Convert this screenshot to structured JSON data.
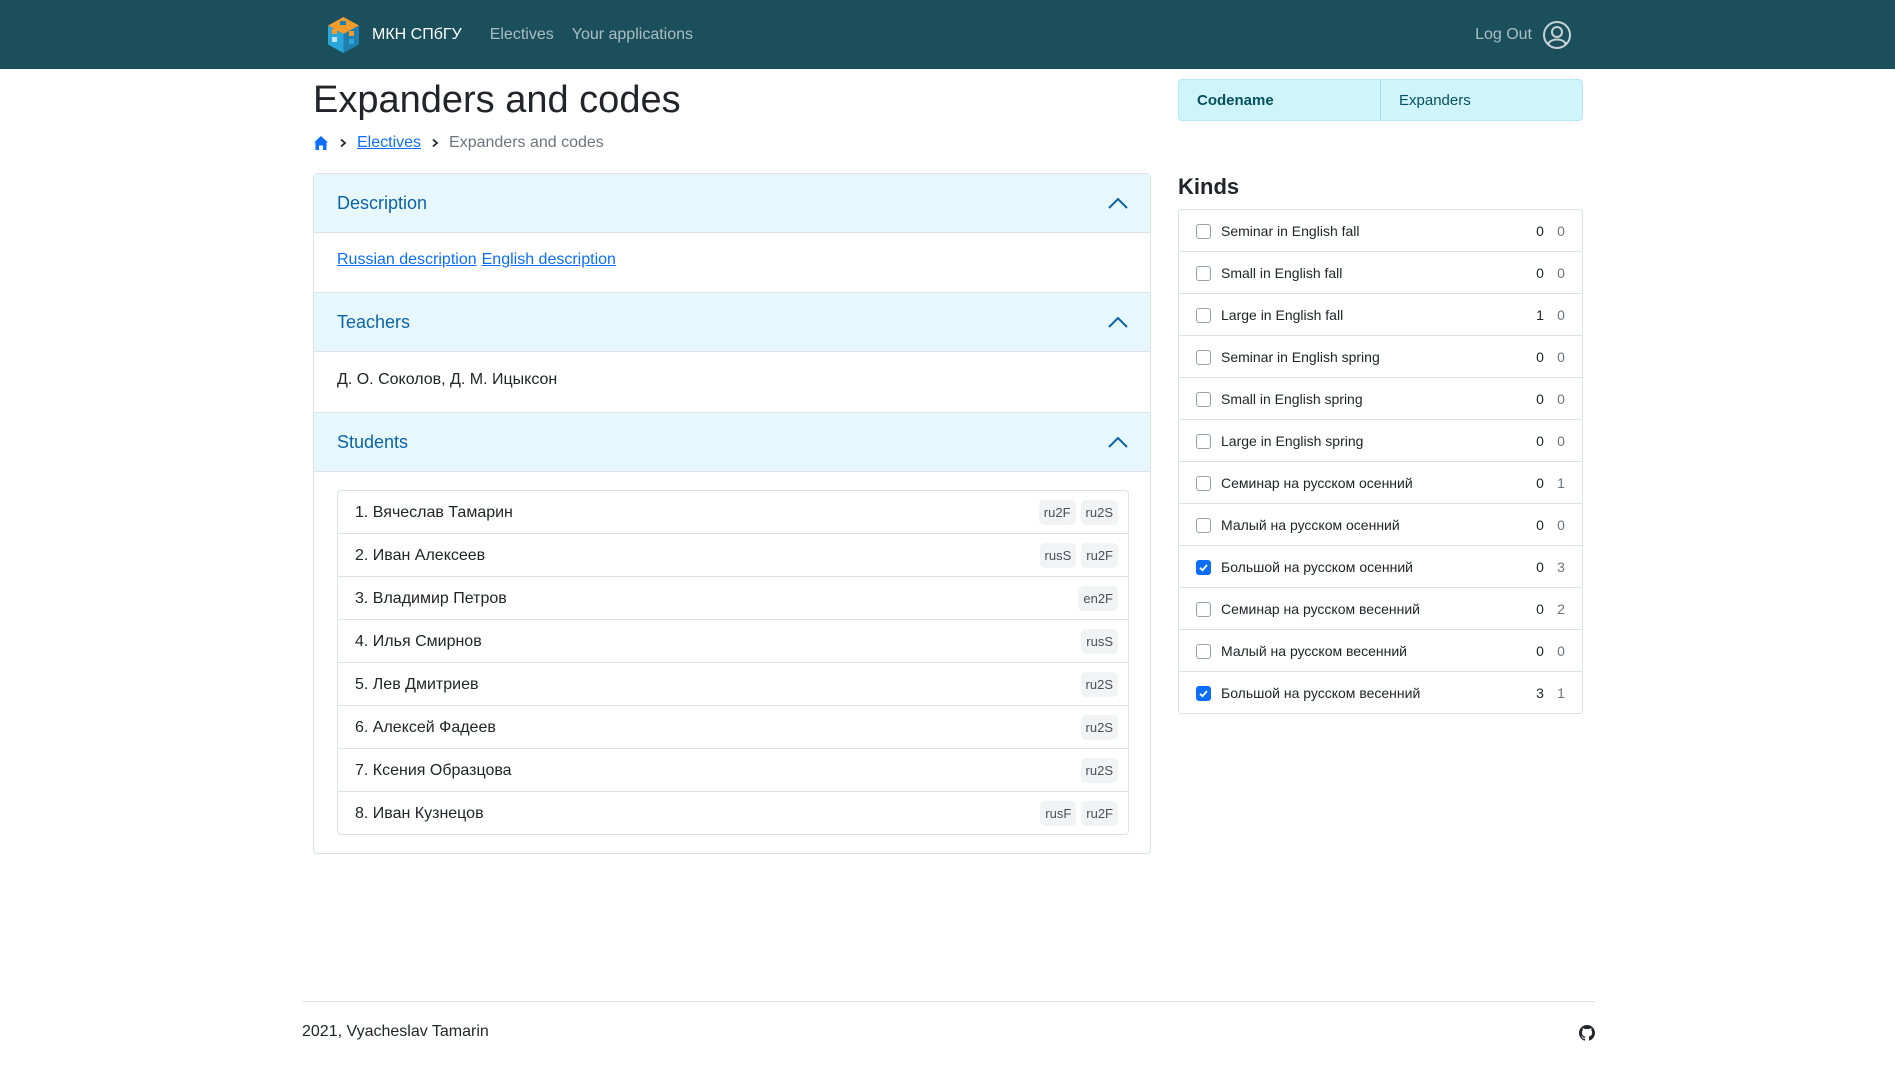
{
  "navbar": {
    "brand": "МКН СПбГУ",
    "links": [
      "Electives",
      "Your applications"
    ],
    "logout": "Log Out"
  },
  "page": {
    "title": "Expanders and codes",
    "breadcrumb": {
      "electives": "Electives",
      "current": "Expanders and codes"
    }
  },
  "accordion": {
    "description": {
      "header": "Description",
      "links": [
        "Russian description",
        "English description"
      ]
    },
    "teachers": {
      "header": "Teachers",
      "text": "Д. О. Соколов, Д. М. Ицыксон"
    },
    "students": {
      "header": "Students",
      "items": [
        {
          "name": "1. Вячеслав Тамарин",
          "badges": [
            "ru2F",
            "ru2S"
          ]
        },
        {
          "name": "2. Иван Алексеев",
          "badges": [
            "rusS",
            "ru2F"
          ]
        },
        {
          "name": "3. Владимир Петров",
          "badges": [
            "en2F"
          ]
        },
        {
          "name": "4. Илья Смирнов",
          "badges": [
            "rusS"
          ]
        },
        {
          "name": "5. Лев Дмитриев",
          "badges": [
            "ru2S"
          ]
        },
        {
          "name": "6. Алексей Фадеев",
          "badges": [
            "ru2S"
          ]
        },
        {
          "name": "7. Ксения Образцова",
          "badges": [
            "ru2S"
          ]
        },
        {
          "name": "8. Иван Кузнецов",
          "badges": [
            "rusF",
            "ru2F"
          ]
        }
      ]
    }
  },
  "tabs": {
    "codename": "Codename",
    "expanders": "Expanders",
    "active": "codename"
  },
  "kinds": {
    "title": "Kinds",
    "items": [
      {
        "label": "Seminar in English fall",
        "a": "0",
        "b": "0",
        "checked": false
      },
      {
        "label": "Small in English fall",
        "a": "0",
        "b": "0",
        "checked": false
      },
      {
        "label": "Large in English fall",
        "a": "1",
        "b": "0",
        "checked": false
      },
      {
        "label": "Seminar in English spring",
        "a": "0",
        "b": "0",
        "checked": false
      },
      {
        "label": "Small in English spring",
        "a": "0",
        "b": "0",
        "checked": false
      },
      {
        "label": "Large in English spring",
        "a": "0",
        "b": "0",
        "checked": false
      },
      {
        "label": "Семинар на русском осенний",
        "a": "0",
        "b": "1",
        "checked": false
      },
      {
        "label": "Малый на русском осенний",
        "a": "0",
        "b": "0",
        "checked": false
      },
      {
        "label": "Большой на русском осенний",
        "a": "0",
        "b": "3",
        "checked": true
      },
      {
        "label": "Семинар на русском весенний",
        "a": "0",
        "b": "2",
        "checked": false
      },
      {
        "label": "Малый на русском весенний",
        "a": "0",
        "b": "0",
        "checked": false
      },
      {
        "label": "Большой на русском весенний",
        "a": "3",
        "b": "1",
        "checked": true
      }
    ]
  },
  "footer": {
    "text": "2021, Vyacheslav Tamarin"
  },
  "colors": {
    "navbar": "#1c4f5c",
    "accent": "#0d6efd",
    "accordion_header_bg": "#e7f8fd",
    "tabs_bg": "#cff4fc"
  },
  "icons": {
    "logo": "cube-logo-icon",
    "user": "user-circle-icon",
    "home": "home-icon",
    "github": "github-icon"
  }
}
